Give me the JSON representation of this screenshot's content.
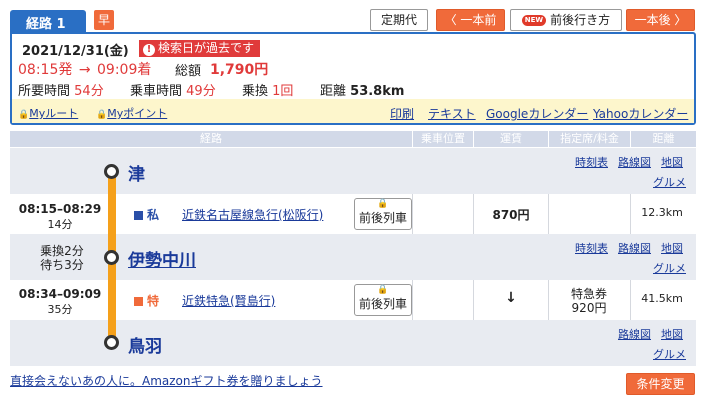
{
  "header": {
    "route_label": "経路 1",
    "badge": "早",
    "buttons": {
      "teiki": "定期代",
      "prev": "〈 一本前",
      "new_badge": "NEW",
      "zengo": "前後行き方",
      "next": "一本後 〉"
    }
  },
  "summary": {
    "date": "2021/12/31(金)",
    "warning": "検索日が過去です",
    "dep_time": "08:15発",
    "arrow": "→",
    "arr_time": "09:09着",
    "fare_label": "総額",
    "fare_value": "1,790円",
    "duration_label": "所要時間",
    "duration_value": "54分",
    "ride_label": "乗車時間",
    "ride_value": "49分",
    "transfer_label": "乗換",
    "transfer_value": "1回",
    "distance_label": "距離",
    "distance_value": "53.8km"
  },
  "links": {
    "my_route": "Myルート",
    "my_point": "Myポイント",
    "print": "印刷",
    "text": "テキスト",
    "google": "Googleカレンダー",
    "yahoo": "Yahooカレンダー"
  },
  "table": {
    "headers": [
      "経路",
      "乗車位置",
      "運賃",
      "指定席/料金",
      "距離"
    ],
    "station_links": {
      "timetable": "時刻表",
      "line_map": "路線図",
      "map": "地図",
      "gourmet": "グルメ"
    },
    "stations": [
      {
        "name": "津"
      },
      {
        "name": "伊勢中川",
        "transfer": "乗換2分",
        "wait": "待ち3分"
      },
      {
        "name": "鳥羽"
      }
    ],
    "segments": [
      {
        "time": "08:15–08:29",
        "mins": "14分",
        "kind": "私",
        "line": "近鉄名古屋線急行(松阪行)",
        "train_btn": "前後列車",
        "fare": "870円",
        "seat": "",
        "seat_price": "",
        "dist": "12.3km"
      },
      {
        "time": "08:34–09:09",
        "mins": "35分",
        "kind": "特",
        "line": "近鉄特急(賢島行)",
        "train_btn": "前後列車",
        "fare": "↓",
        "seat": "特急券",
        "seat_price": "920円",
        "dist": "41.5km"
      }
    ]
  },
  "footer": {
    "promo": "直接会えないあの人に。Amazonギフト券を贈りましょう",
    "change_button": "条件変更"
  }
}
